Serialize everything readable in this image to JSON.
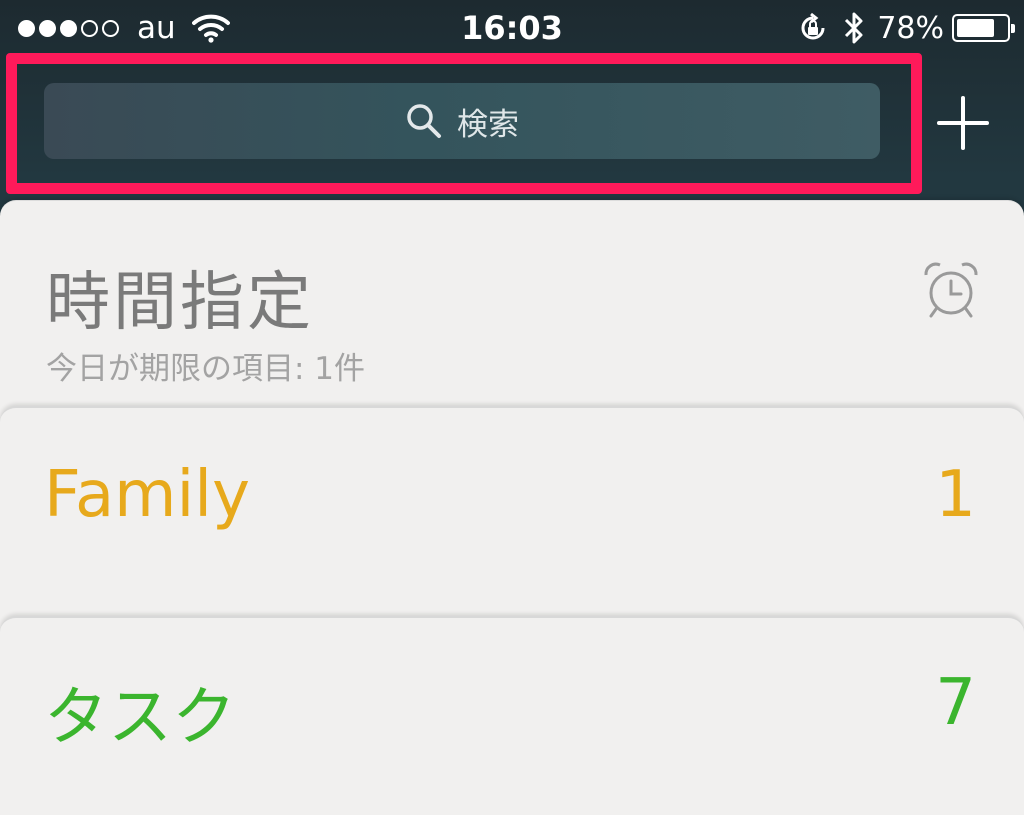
{
  "status_bar": {
    "carrier": "au",
    "time": "16:03",
    "battery_percent": "78%",
    "battery_level": 0.78,
    "signal_bars_filled": 3,
    "signal_bars_total": 5,
    "icons": [
      "wifi-icon",
      "rotation-lock-icon",
      "bluetooth-icon",
      "battery-icon"
    ]
  },
  "search": {
    "placeholder": "検索",
    "highlight_color": "#ff1a5a"
  },
  "toolbar": {
    "add_icon": "plus-icon"
  },
  "scheduled": {
    "title": "時間指定",
    "subtitle": "今日が期限の項目: 1件",
    "icon": "alarm-clock-icon"
  },
  "lists": [
    {
      "name": "Family",
      "count": "1",
      "color": "#e7a91c"
    },
    {
      "name": "タスク",
      "count": "7",
      "color": "#3bb52e"
    }
  ]
}
